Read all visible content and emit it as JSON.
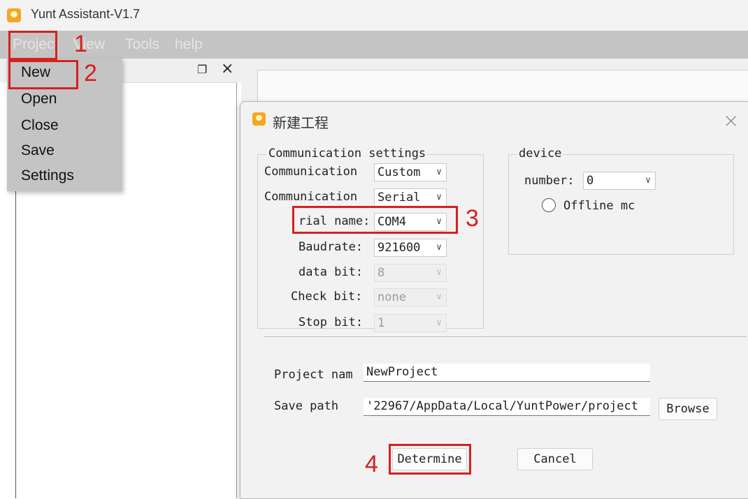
{
  "window": {
    "title": "Yunt Assistant-V1.7"
  },
  "menubar": {
    "items": [
      "Project",
      "View",
      "Tools",
      "help"
    ]
  },
  "project_menu": {
    "items": [
      "New",
      "Open",
      "Close",
      "Save",
      "Settings"
    ]
  },
  "dock": {
    "float_icon": "restore-icon",
    "close_label": "×"
  },
  "annotations": [
    "1",
    "2",
    "3",
    "4"
  ],
  "dialog": {
    "title": "新建工程",
    "close_label": "×",
    "comm": {
      "legend": "Communication settings",
      "rows": [
        {
          "label": "Communication",
          "value": "Custom"
        },
        {
          "label": "Communication",
          "value": "Serial"
        },
        {
          "label": "rial name:",
          "value": "COM4"
        },
        {
          "label": "Baudrate:",
          "value": "921600"
        },
        {
          "label": "data bit:",
          "value": "8"
        },
        {
          "label": "Check bit:",
          "value": "none"
        },
        {
          "label": "Stop bit:",
          "value": "1"
        }
      ]
    },
    "device": {
      "legend": "device",
      "number_label": "number:",
      "number_value": "0",
      "offline_label": "Offline mc"
    },
    "project_name_label": "Project nam",
    "project_name_value": "NewProject",
    "save_path_label": "Save path",
    "save_path_value": "'22967/AppData/Local/YuntPower/project",
    "browse_label": "Browse",
    "determine_label": "Determine",
    "cancel_label": "Cancel"
  },
  "colors": {
    "annotation_red": "#d62020",
    "icon_orange": "#f5a623",
    "menubar_gray": "#c4c4c4"
  }
}
